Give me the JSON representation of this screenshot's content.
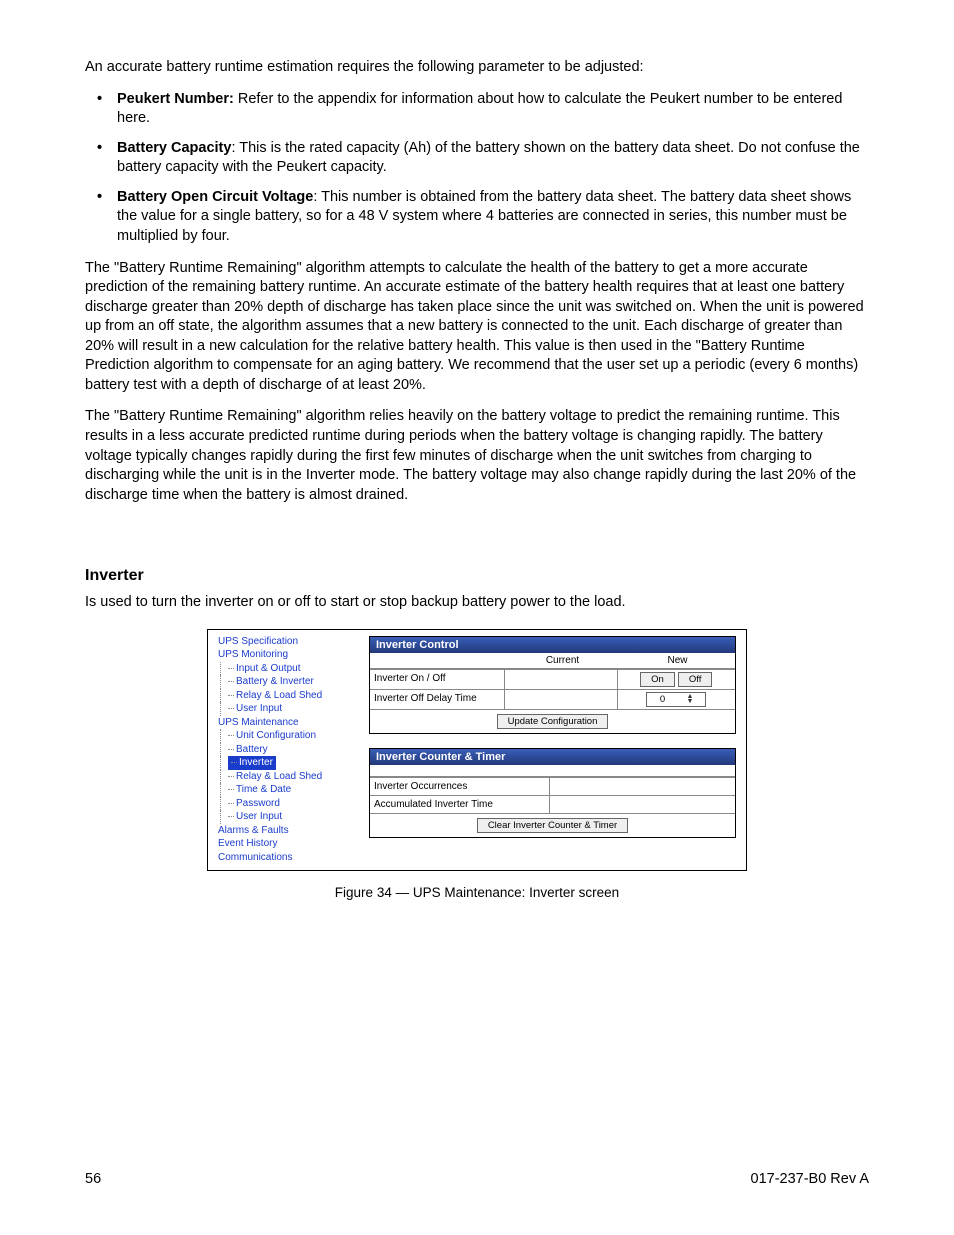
{
  "intro": "An accurate battery runtime estimation requires the following parameter to be adjusted:",
  "bullets": [
    {
      "label": "Peukert Number:",
      "text": " Refer to the appendix for information about how to calculate the Peukert number to be entered here."
    },
    {
      "label": "Battery Capacity",
      "text": ": This is the rated capacity (Ah) of the battery shown on the battery data sheet. Do not confuse the battery capacity with the Peukert capacity."
    },
    {
      "label": "Battery Open Circuit Voltage",
      "text": ": This number is obtained from the battery data sheet. The battery data sheet shows the value for a single battery, so for a 48 V system where 4 batteries are connected in series, this number must be multiplied by four."
    }
  ],
  "para1": "The \"Battery Runtime Remaining\" algorithm attempts to calculate the health of the battery to get a more accurate prediction of the remaining battery runtime. An accurate estimate of the battery health requires that at least one battery discharge greater than 20% depth of discharge has taken place since the unit was switched on. When the unit is powered up from an off state, the algorithm assumes that a new battery is connected to the unit. Each discharge of greater than 20% will result in a new calculation for the relative battery health. This value is then used in the \"Battery Runtime Prediction algorithm to compensate for an aging battery. We recommend that the user set up a periodic (every 6 months) battery test with a depth of discharge of at least 20%.",
  "para2": "The \"Battery Runtime Remaining\" algorithm relies heavily on the battery voltage to predict the remaining runtime. This results in a less accurate predicted runtime during periods when the battery voltage is changing rapidly. The battery voltage typically changes rapidly during the first few minutes of discharge when the unit switches from charging to discharging while the unit is in the Inverter mode. The battery voltage may also change rapidly during the last 20% of the discharge time when the battery is almost drained.",
  "section_heading": "Inverter",
  "section_intro": "Is used to turn the inverter on or off to start or stop backup battery power to the load.",
  "tree": {
    "ups_spec": "UPS Specification",
    "ups_mon": "UPS Monitoring",
    "mon_io": "Input & Output",
    "mon_bi": "Battery & Inverter",
    "mon_rls": "Relay & Load Shed",
    "mon_ui": "User Input",
    "ups_maint": "UPS Maintenance",
    "mnt_uc": "Unit Configuration",
    "mnt_bat": "Battery",
    "mnt_inv": "Inverter",
    "mnt_rls": "Relay & Load Shed",
    "mnt_td": "Time & Date",
    "mnt_pw": "Password",
    "mnt_ui": "User Input",
    "alarms": "Alarms & Faults",
    "evhist": "Event History",
    "comms": "Communications"
  },
  "panel1": {
    "title": "Inverter Control",
    "col_current": "Current",
    "col_new": "New",
    "row1_label": "Inverter On / Off",
    "row1_on": "On",
    "row1_off": "Off",
    "row2_label": "Inverter Off Delay Time",
    "row2_value": "0",
    "update_btn": "Update Configuration"
  },
  "panel2": {
    "title": "Inverter Counter & Timer",
    "row1_label": "Inverter Occurrences",
    "row2_label": "Accumulated Inverter Time",
    "clear_btn": "Clear Inverter Counter & Timer"
  },
  "caption": "Figure 34  —  UPS Maintenance: Inverter screen",
  "footer": {
    "page": "56",
    "doc": "017-237-B0    Rev A"
  }
}
